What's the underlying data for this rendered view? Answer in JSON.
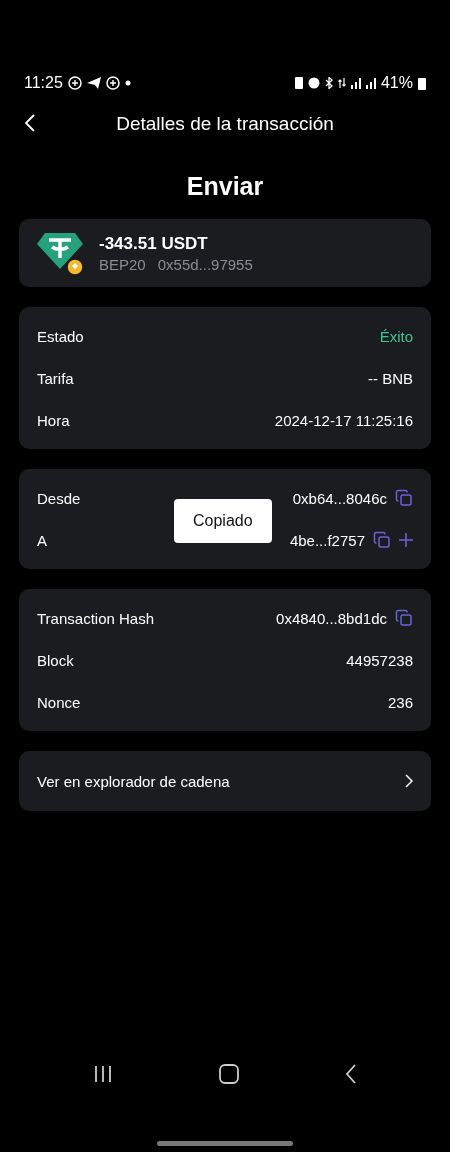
{
  "status_bar": {
    "time": "11:25",
    "battery": "41%"
  },
  "header": {
    "title": "Detalles de la transacción"
  },
  "heading": "Enviar",
  "token": {
    "amount": "-343.51 USDT",
    "network": "BEP20",
    "contract": "0x55d...97955"
  },
  "sections": [
    {
      "rows": [
        {
          "label": "Estado",
          "value": "Éxito",
          "kind": "status"
        },
        {
          "label": "Tarifa",
          "value": "-- BNB",
          "kind": "text"
        },
        {
          "label": "Hora",
          "value": "2024-12-17 11:25:16",
          "kind": "text"
        }
      ]
    },
    {
      "rows": [
        {
          "label": "Desde",
          "value": "0xb64...8046c",
          "kind": "copy"
        },
        {
          "label": "A",
          "value": "4be...f2757",
          "kind": "copy_add"
        }
      ]
    },
    {
      "rows": [
        {
          "label": "Transaction Hash",
          "value": "0x4840...8bd1dc",
          "kind": "copy"
        },
        {
          "label": "Block",
          "value": "44957238",
          "kind": "text"
        },
        {
          "label": "Nonce",
          "value": "236",
          "kind": "text"
        }
      ]
    }
  ],
  "explorer_link": "Ver en explorador de cadena",
  "toast": "Copiado"
}
